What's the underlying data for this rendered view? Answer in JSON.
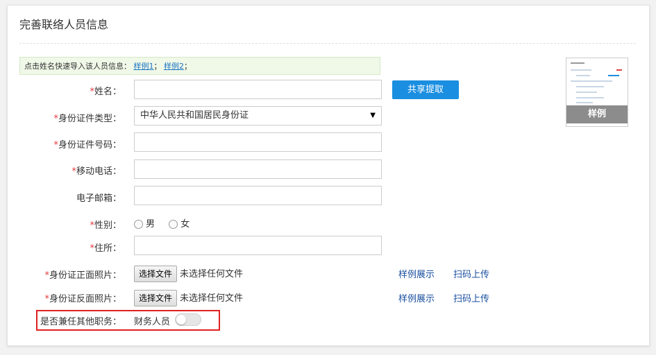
{
  "page_title": "完善联络人员信息",
  "hint": {
    "text": "点击姓名快速导入该人员信息：",
    "sample1": "样例1",
    "sep1": "；",
    "sample2": "样例2",
    "sep2": "；"
  },
  "form": {
    "name_label": "姓名：",
    "id_type_label": "身份证件类型：",
    "id_type_value": "中华人民共和国居民身份证",
    "id_number_label": "身份证件号码：",
    "phone_label": "移动电话：",
    "email_label": "电子邮箱：",
    "gender_label": "性别：",
    "gender_options": [
      "男",
      "女"
    ],
    "address_label": "住所：",
    "id_front_label": "身份证正面照片：",
    "id_back_label": "身份证反面照片：",
    "choose_file_label": "选择文件",
    "no_file_text": "未选择任何文件",
    "other_role_label": "是否兼任其他职务：",
    "finance_label": "财务人员",
    "required_mark": "*"
  },
  "share_button": "共享提取",
  "sample_thumb_label": "样例",
  "links": {
    "sample_show": "样例展示",
    "scan_upload": "扫码上传"
  },
  "colors": {
    "accent": "#1a8ee0",
    "required": "#e4393c",
    "highlight_border": "#e02020"
  }
}
